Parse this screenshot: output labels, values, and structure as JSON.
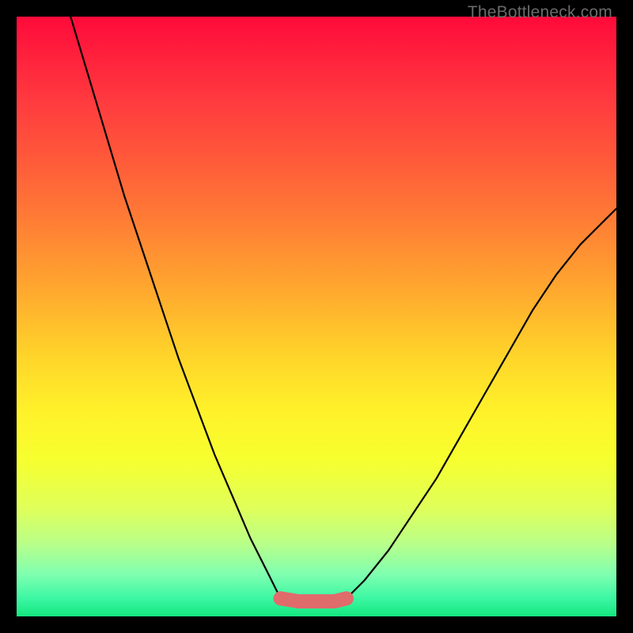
{
  "watermark": "TheBottleneck.com",
  "chart_data": {
    "type": "line",
    "title": "",
    "xlabel": "",
    "ylabel": "",
    "xlim": [
      0,
      1
    ],
    "ylim": [
      0,
      1
    ],
    "series": [
      {
        "name": "left-curve",
        "x": [
          0.09,
          0.12,
          0.15,
          0.18,
          0.21,
          0.24,
          0.27,
          0.3,
          0.33,
          0.36,
          0.39,
          0.42,
          0.44
        ],
        "y": [
          1.0,
          0.9,
          0.8,
          0.7,
          0.61,
          0.52,
          0.43,
          0.35,
          0.27,
          0.2,
          0.13,
          0.07,
          0.03
        ]
      },
      {
        "name": "basin",
        "x": [
          0.44,
          0.47,
          0.5,
          0.53,
          0.55
        ],
        "y": [
          0.03,
          0.025,
          0.025,
          0.025,
          0.03
        ]
      },
      {
        "name": "right-curve",
        "x": [
          0.55,
          0.58,
          0.62,
          0.66,
          0.7,
          0.74,
          0.78,
          0.82,
          0.86,
          0.9,
          0.94,
          0.98,
          1.0
        ],
        "y": [
          0.03,
          0.06,
          0.11,
          0.17,
          0.23,
          0.3,
          0.37,
          0.44,
          0.51,
          0.57,
          0.62,
          0.66,
          0.68
        ]
      }
    ],
    "highlight": {
      "color": "#e06b6b",
      "points_x": [
        0.44,
        0.47,
        0.5,
        0.53,
        0.55
      ],
      "points_y": [
        0.03,
        0.025,
        0.025,
        0.025,
        0.03
      ]
    }
  }
}
